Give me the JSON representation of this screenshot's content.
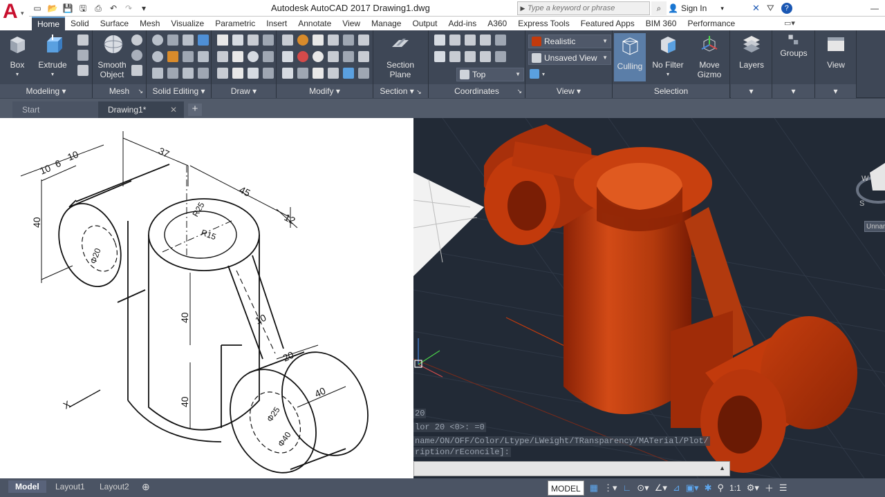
{
  "app": {
    "window_title": "Autodesk AutoCAD 2017    Drawing1.dwg",
    "search_placeholder": "Type a keyword or phrase",
    "sign_in": "Sign In"
  },
  "ribbon_tabs": [
    "Home",
    "Solid",
    "Surface",
    "Mesh",
    "Visualize",
    "Parametric",
    "Insert",
    "Annotate",
    "View",
    "Manage",
    "Output",
    "Add-ins",
    "A360",
    "Express Tools",
    "Featured Apps",
    "BIM 360",
    "Performance"
  ],
  "active_tab": "Home",
  "panels": {
    "modeling": {
      "title": "Modeling",
      "box": "Box",
      "extrude": "Extrude"
    },
    "mesh": {
      "title": "Mesh",
      "smooth_object": "Smooth Object"
    },
    "solid_editing": {
      "title": "Solid Editing"
    },
    "draw": {
      "title": "Draw"
    },
    "modify": {
      "title": "Modify"
    },
    "section": {
      "title": "Section",
      "section_plane": "Section Plane"
    },
    "coordinates": {
      "title": "Coordinates",
      "view_select": "Top"
    },
    "view": {
      "title": "View",
      "visual_style": "Realistic",
      "named_view": "Unsaved View"
    },
    "selection": {
      "title": "Selection",
      "culling": "Culling",
      "no_filter": "No Filter",
      "move_gizmo": "Move Gizmo"
    },
    "layers": {
      "title": "Layers"
    },
    "groups": {
      "title": "Groups"
    },
    "view2": {
      "title": "View"
    }
  },
  "doc_tabs": {
    "start": "Start",
    "drawing": "Drawing1*"
  },
  "sketch_dims": {
    "d37": "37",
    "d45": "45",
    "d12": "12",
    "d10a": "10",
    "d6": "6",
    "d10b": "10",
    "d40left": "40",
    "r25": "R25",
    "r15": "R15",
    "phi20": "Φ20",
    "d40mid": "40",
    "d40low": "40",
    "d10rib": "10",
    "d20": "20",
    "phi25": "Φ25",
    "phi40": "Φ40",
    "d40bottom": "40",
    "x_axis": "X"
  },
  "command_lines": [
    "20",
    "lor 20 <0>: =0",
    "name/ON/OFF/Color/Ltype/LWeight/TRansparency/MATerial/Plot/",
    "ription/rEconcile]:"
  ],
  "viewcube": {
    "unnamed": "Unnar",
    "w": "W",
    "s": "S"
  },
  "layout_tabs": [
    "Model",
    "Layout1",
    "Layout2"
  ],
  "status": {
    "model": "MODEL",
    "scale": "1:1"
  },
  "colors": {
    "ribbon": "#3e4756",
    "solid": "#c23a0c",
    "viewport": "#222a36",
    "accent": "#5d9ed8"
  }
}
